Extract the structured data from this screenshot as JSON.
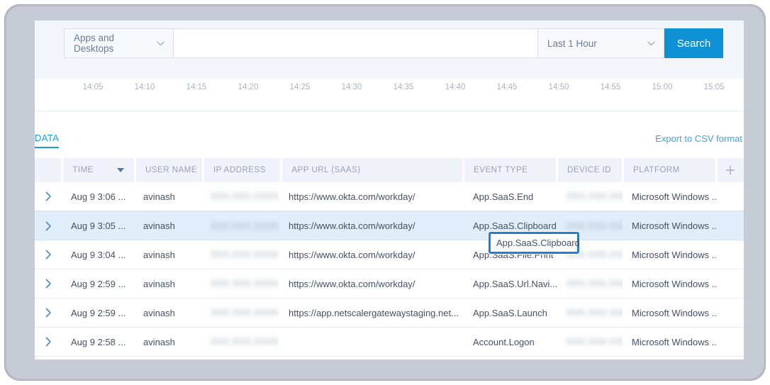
{
  "search_bar": {
    "category_select": {
      "value": "Apps and Desktops",
      "icon": "chevron-down-icon"
    },
    "query_input": {
      "value": "",
      "placeholder": ""
    },
    "time_select": {
      "value": "Last 1 Hour",
      "icon": "chevron-down-icon"
    },
    "search_button": {
      "label": "Search",
      "color": "#0f91d6"
    }
  },
  "chart_axis": {
    "ticks": [
      "14:05",
      "14:10",
      "14:15",
      "14:20",
      "14:25",
      "14:30",
      "14:35",
      "14:40",
      "14:45",
      "14:50",
      "14:55",
      "15:00",
      "15:05"
    ]
  },
  "tabs": {
    "data_tab": "DATA",
    "export_link": "Export to CSV format",
    "accent": "#1b9bd8"
  },
  "table": {
    "columns": [
      {
        "key": "expander",
        "label": ""
      },
      {
        "key": "time",
        "label": "TIME",
        "sorted": true,
        "sort_icon": "sort-caret-down-icon"
      },
      {
        "key": "user_name",
        "label": "USER NAME"
      },
      {
        "key": "ip_address",
        "label": "IP ADDRESS"
      },
      {
        "key": "app_url",
        "label": "APP URL (SAAS)"
      },
      {
        "key": "event_type",
        "label": "EVENT TYPE"
      },
      {
        "key": "device_id",
        "label": "DEVICE ID"
      },
      {
        "key": "platform",
        "label": "PLATFORM"
      },
      {
        "key": "add_column",
        "label": "",
        "icon": "plus-icon"
      }
    ],
    "rows": [
      {
        "time": "Aug 9 3:06 ...",
        "user_name": "avinash",
        "ip_address": "",
        "ip_truncated": "..",
        "app_url": "https://www.okta.com/workday/",
        "event_type": "App.SaaS.End",
        "device_id": "",
        "platform": "Microsoft Windows ...",
        "selected": false
      },
      {
        "time": "Aug 9 3:05 ...",
        "user_name": "avinash",
        "ip_address": "",
        "ip_truncated": "..",
        "app_url": "https://www.okta.com/workday/",
        "event_type": "App.SaaS.Clipboard",
        "device_id": "",
        "platform": "Microsoft Windows ...",
        "selected": true,
        "highlighted_cell": "event_type"
      },
      {
        "time": "Aug 9 3:04 ...",
        "user_name": "avinash",
        "ip_address": "",
        "ip_truncated": "..",
        "app_url": "https://www.okta.com/workday/",
        "event_type": "App.SaaS.File.Print",
        "device_id": "",
        "platform": "Microsoft Windows ...",
        "selected": false
      },
      {
        "time": "Aug 9 2:59 ...",
        "user_name": "avinash",
        "ip_address": "",
        "ip_truncated": "..",
        "app_url": "https://www.okta.com/workday/",
        "event_type": "App.SaaS.Url.Navi...",
        "device_id": "",
        "platform": "Microsoft Windows ...",
        "selected": false
      },
      {
        "time": "Aug 9 2:59 ...",
        "user_name": "avinash",
        "ip_address": "",
        "ip_truncated": "..",
        "app_url": "https://app.netscalergatewaystaging.net...",
        "event_type": "App.SaaS.Launch",
        "device_id": "",
        "platform": "Microsoft Windows ...",
        "selected": false
      },
      {
        "time": "Aug 9 2:58 ...",
        "user_name": "avinash",
        "ip_address": "",
        "ip_truncated": "..",
        "app_url": "",
        "event_type": "Account.Logon",
        "device_id": "",
        "platform": "Microsoft Windows ...",
        "selected": false
      }
    ],
    "masked_placeholder": "XXX.XXX.XXXX",
    "highlight_color": "#1f7fd4",
    "highlight_label": "App.SaaS.Clipboard"
  }
}
